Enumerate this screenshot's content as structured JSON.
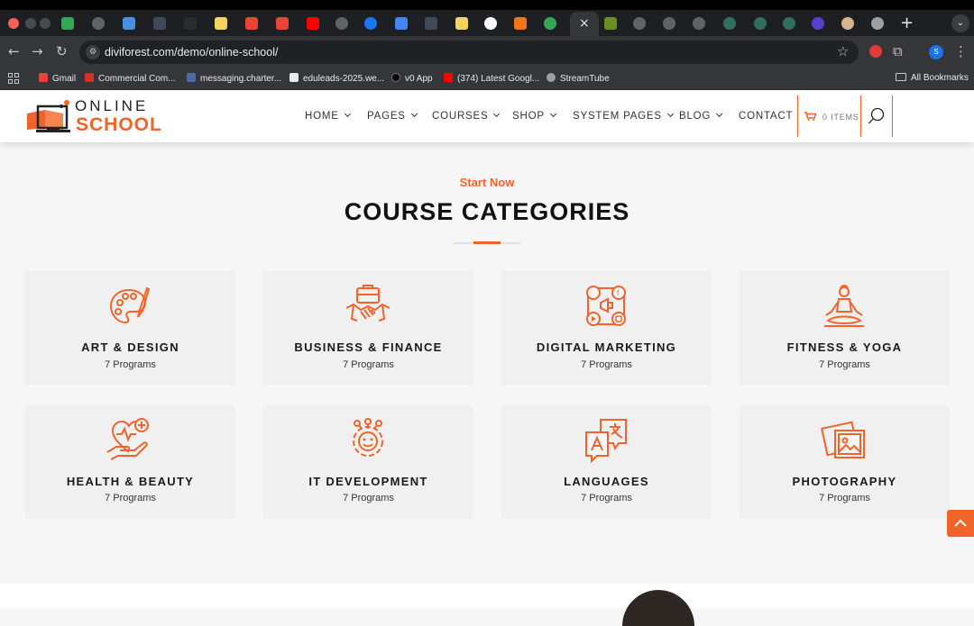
{
  "browser": {
    "url": "diviforest.com/demo/online-school/",
    "tab_close": "×",
    "new_tab": "+",
    "bookmarks": [
      {
        "label": "Gmail",
        "color": "#ea4335"
      },
      {
        "label": "Commercial Com...",
        "color": "#d93025"
      },
      {
        "label": "messaging.charter...",
        "color": "#4a6da7"
      },
      {
        "label": "eduleads-2025.we...",
        "color": "#e8eaed"
      },
      {
        "label": "v0 App",
        "color": "#000000"
      },
      {
        "label": "(374) Latest Googl...",
        "color": "#ff0000"
      },
      {
        "label": "StreamTube",
        "color": "#9aa0a6"
      }
    ],
    "all_bookmarks": "All Bookmarks",
    "profile_initial": "S"
  },
  "site": {
    "logo_line1": "ONLINE",
    "logo_line2": "SCHOOL",
    "menu": [
      "HOME",
      "PAGES",
      "COURSES",
      "SHOP",
      "SYSTEM PAGES",
      "BLOG",
      "CONTACT"
    ],
    "cart_label": "0 ITEMS",
    "accent_color": "#f0642c"
  },
  "section": {
    "eyebrow": "Start Now",
    "title": "COURSE CATEGORIES"
  },
  "categories": [
    {
      "title": "ART & DESIGN",
      "programs": "7 Programs",
      "icon": "palette-icon"
    },
    {
      "title": "BUSINESS & FINANCE",
      "programs": "7 Programs",
      "icon": "handshake-icon"
    },
    {
      "title": "DIGITAL MARKETING",
      "programs": "7 Programs",
      "icon": "social-media-icon"
    },
    {
      "title": "FITNESS & YOGA",
      "programs": "7 Programs",
      "icon": "yoga-icon"
    },
    {
      "title": "HEALTH & BEAUTY",
      "programs": "7 Programs",
      "icon": "health-icon"
    },
    {
      "title": "IT DEVELOPMENT",
      "programs": "7 Programs",
      "icon": "developer-icon"
    },
    {
      "title": "LANGUAGES",
      "programs": "7 Programs",
      "icon": "translate-icon"
    },
    {
      "title": "PHOTOGRAPHY",
      "programs": "7 Programs",
      "icon": "photo-icon"
    }
  ]
}
